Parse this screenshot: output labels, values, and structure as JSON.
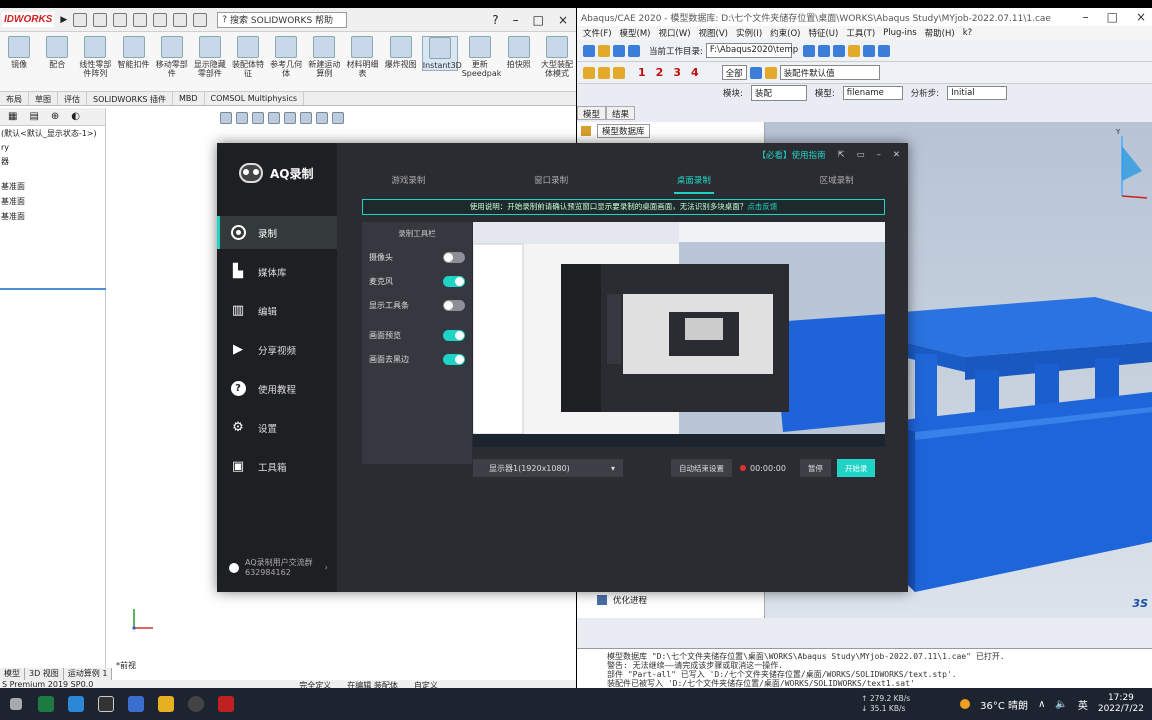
{
  "solidworks": {
    "logo": "IDWORKS",
    "search_placeholder": "搜索 SOLIDWORKS 帮助",
    "cmd_items": [
      "镜像",
      "配合",
      "线性零部件阵列",
      "智能扣件",
      "移动零部件",
      "显示隐藏零部件",
      "装配体特征",
      "参考几何体",
      "新建运动算例",
      "材料明细表",
      "爆炸视图",
      "Instant3D",
      "更新Speedpak",
      "拍快照",
      "大型装配体模式"
    ],
    "tabs": [
      "布局",
      "草图",
      "评估",
      "SOLIDWORKS 插件",
      "MBD",
      "COMSOL Multiphysics"
    ],
    "tree_items": [
      "(默认<默认_显示状态-1>)",
      "ry",
      "器",
      "",
      "基准面",
      "基准面",
      "基准面"
    ],
    "front_label": "*前视",
    "bottom_tabs": [
      "模型",
      "3D 视图",
      "运动算例 1"
    ],
    "status": [
      "S Premium 2019 SP0.0",
      "完全定义",
      "在编辑 装配体",
      "自定义"
    ]
  },
  "abaqus": {
    "title": "Abaqus/CAE 2020 - 模型数据库: D:\\七个文件夹储存位置\\桌面\\WORKS\\Abaqus Study\\MYjob-2022.07.11\\1.cae [Viewport: 1]",
    "menu": [
      "文件(F)",
      "模型(M)",
      "视口(W)",
      "视图(V)",
      "实例(I)",
      "约束(O)",
      "特征(U)",
      "工具(T)",
      "Plug-ins",
      "帮助(H)",
      "k?"
    ],
    "workdir_label": "当前工作目录:",
    "workdir_value": "F:\\Abaqus2020\\temp",
    "select_all": "全部",
    "assembly_default": "装配件默认值",
    "numbers": [
      "1",
      "2",
      "3",
      "4"
    ],
    "module_label": "模块:",
    "module_value": "装配",
    "model_label": "模型:",
    "model_value": "filename",
    "step_label": "分析步:",
    "step_value": "Initial",
    "tabs": [
      "模型",
      "结果"
    ],
    "tree_header": "模型数据库",
    "tree_bottom": "优化进程",
    "messages": [
      "模型数据库 \"D:\\七个文件夹储存位置\\桌面\\WORKS\\Abaqus Study\\MYjob-2022.07.11\\1.cae\" 已打开.",
      "警告: 无法继续——请完成该步骤或取消这一操作.",
      "部件 \"Part-all\" 已写入 'D:/七个文件夹储存位置/桌面/WORKS/SOLIDWORKS/text.stp'.",
      "装配件已被写入 'D:/七个文件夹储存位置/桌面/WORKS/SOLIDWORKS/text1.sat'"
    ]
  },
  "aq": {
    "brand": "AQ录制",
    "guide": "【必看】使用指南",
    "nav": [
      {
        "label": "录制",
        "icon": "record-icon"
      },
      {
        "label": "媒体库",
        "icon": "media-library-icon"
      },
      {
        "label": "编辑",
        "icon": "edit-icon"
      },
      {
        "label": "分享视频",
        "icon": "share-video-icon"
      },
      {
        "label": "使用教程",
        "icon": "help-icon"
      },
      {
        "label": "设置",
        "icon": "settings-icon"
      },
      {
        "label": "工具箱",
        "icon": "toolbox-icon"
      }
    ],
    "group_line1": "AQ录制用户交流群",
    "group_line2": "632984162",
    "tabs": [
      "游戏录制",
      "窗口录制",
      "桌面录制",
      "区域录制"
    ],
    "active_tab": 2,
    "notice_text": "使用说明：开始录制前请确认预览窗口显示要录制的桌面画面，无法识别多块桌面？",
    "notice_link": "点击反馈",
    "panel_title": "录制工具栏",
    "options": [
      {
        "label": "摄像头",
        "on": false
      },
      {
        "label": "麦克风",
        "on": true
      },
      {
        "label": "显示工具条",
        "on": false
      },
      {
        "label": "画面预览",
        "on": true
      },
      {
        "label": "画面去黑边",
        "on": true
      }
    ],
    "monitor": "显示器1(1920x1080)",
    "auto_stop": "自动结束设置",
    "timer": "00:00:00",
    "pause": "暂停",
    "start": "开始录"
  },
  "taskbar": {
    "net_up": "279.2 KB/s",
    "net_down": "35.1 KB/s",
    "weather": "36°C 晴朗",
    "ime": "英",
    "time": "17:29",
    "date": "2022/7/22"
  },
  "colors": {
    "accent": "#1fd4c6",
    "abaqus_model": "#1f6bd6"
  }
}
